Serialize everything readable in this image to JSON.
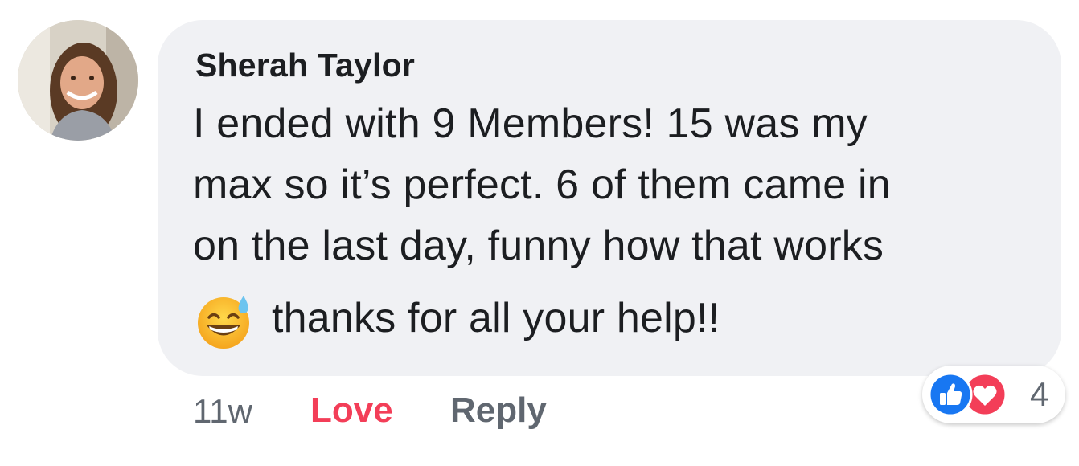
{
  "comment": {
    "author": "Sherah Taylor",
    "lines": [
      "I ended with 9 Members! 15 was my",
      "max so it’s perfect. 6 of them came in",
      "on the last day, funny how that works",
      "thanks for all your help!!"
    ],
    "emoji": "grinning-face-with-sweat",
    "timestamp": "11w",
    "love_label": "Love",
    "reply_label": "Reply",
    "reactions": {
      "types": [
        "like",
        "love"
      ],
      "count": "4"
    }
  },
  "colors": {
    "bubble": "#f0f1f4",
    "love": "#f33e58",
    "like": "#1877f2",
    "muted": "#606770",
    "text": "#1c1e21"
  }
}
